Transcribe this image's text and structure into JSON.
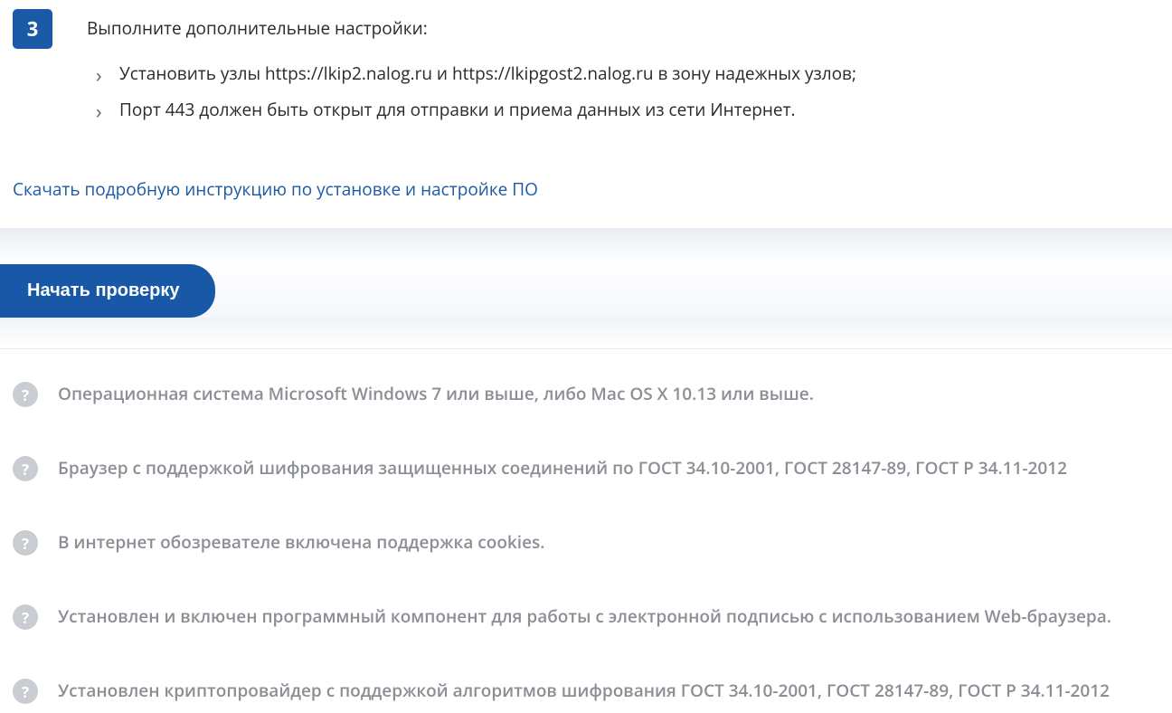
{
  "step": {
    "number": "3",
    "intro": "Выполните дополнительные настройки:",
    "items": [
      "Установить узлы https://lkip2.nalog.ru и https://lkipgost2.nalog.ru в зону надежных узлов;",
      "Порт 443 должен быть открыт для отправки и приема данных из сети Интернет."
    ]
  },
  "download_link": "Скачать подробную инструкцию по установке и настройке ПО",
  "start_button": "Начать проверку",
  "checklist": [
    "Операционная система Microsoft Windows 7 или выше, либо Mac OS X 10.13 или выше.",
    "Браузер с поддержкой шифрования защищенных соединений по ГОСТ 34.10-2001, ГОСТ 28147-89, ГОСТ Р 34.11-2012",
    "В интернет обозревателе включена поддержка cookies.",
    "Установлен и включен программный компонент для работы с электронной подписью с использованием Web-браузера.",
    "Установлен криптопровайдер с поддержкой алгоритмов шифрования ГОСТ 34.10-2001, ГОСТ 28147-89, ГОСТ Р 34.11-2012"
  ]
}
